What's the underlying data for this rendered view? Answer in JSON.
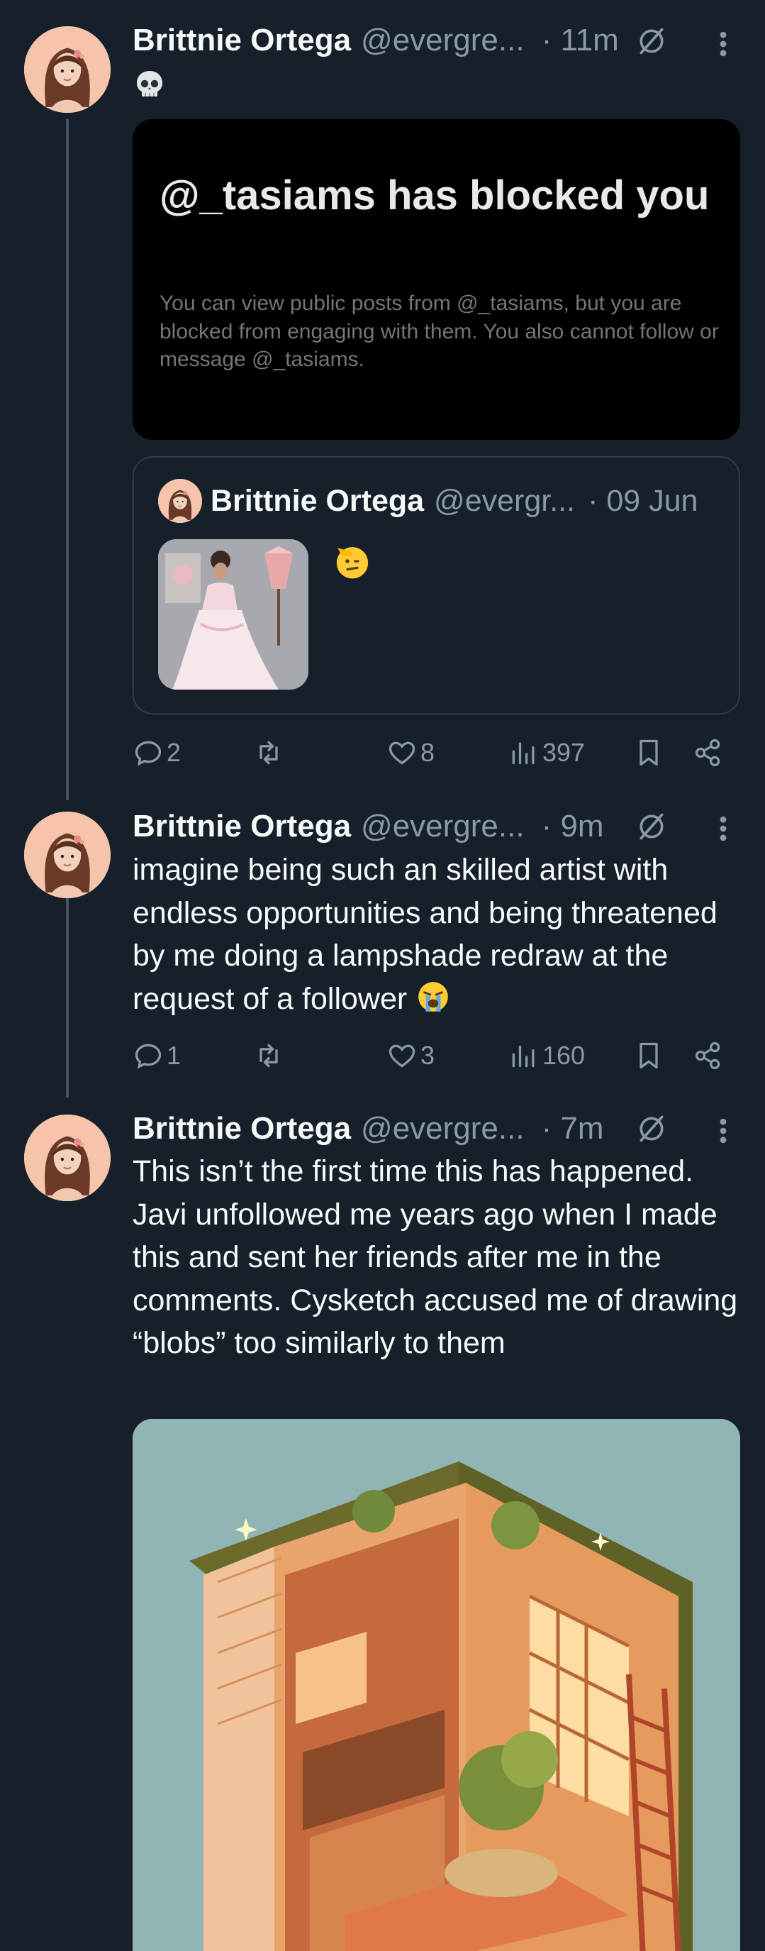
{
  "colors": {
    "background": "#15202b",
    "text": "#f7f9f9",
    "muted": "#8b98a5",
    "card": "#000000",
    "thread": "#425364"
  },
  "posts": [
    {
      "name": "Brittnie Ortega",
      "handle": "@evergre...",
      "time": "· 11m",
      "text_emoji": "skull",
      "blocked_card": {
        "title": "@_tasiams has blocked you",
        "description": "You can view public posts from @_tasiams, but you are blocked from engaging with them. You also cannot follow or message @_tasiams."
      },
      "quote": {
        "name": "Brittnie Ortega",
        "handle": "@evergr...",
        "time": "· 09 Jun",
        "emoji": "saluting-face"
      },
      "replies": "2",
      "reposts": "",
      "likes": "8",
      "views": "397"
    },
    {
      "name": "Brittnie Ortega",
      "handle": "@evergre...",
      "time": "· 9m",
      "text": "imagine being such an skilled artist with endless opportunities and being threatened by me doing a lampshade redraw at the request of a follower",
      "replies": "1",
      "reposts": "",
      "likes": "3",
      "views": "160"
    },
    {
      "name": "Brittnie Ortega",
      "handle": "@evergre...",
      "time": "· 7m",
      "text": "This isn’t the first time this has happened. Javi unfollowed me years ago when I made this and sent her friends after me in the comments. Cysketch accused me of drawing “blobs” too similarly to them"
    }
  ]
}
